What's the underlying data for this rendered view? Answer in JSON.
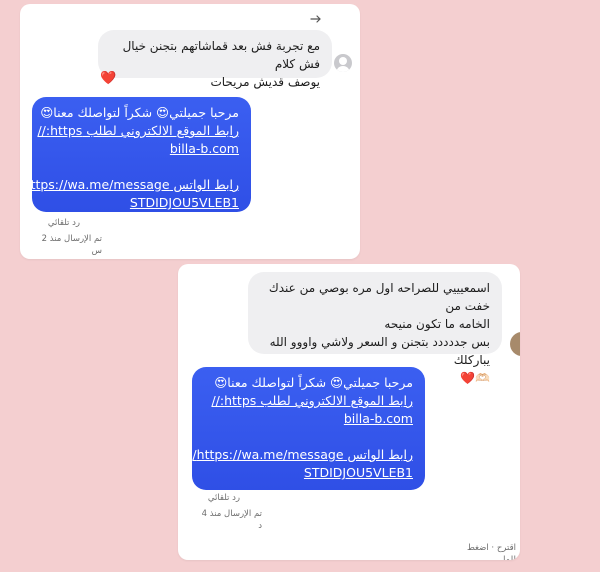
{
  "screenshot_1": {
    "incoming_message": {
      "line1": "مع تجربة فش بعد قماشاتهم بتجنن خيال فش كلام",
      "line2": "يوصف قديش مريحات"
    },
    "reaction": "❤️",
    "reply": {
      "line1": "مرحبا جميلتي😍 شكراً لتواصلك معنا😍",
      "line2": "رابط الموقع الالكتروني لطلب  https://",
      "line3": "billa-b.com",
      "line4": "رابط الواتس https://wa.me/message/",
      "line5": "STDIDJOU5VLEB1"
    },
    "meta_auto_reply": "رد تلقائي",
    "meta_sent": "تم الإرسال منذ 2 س"
  },
  "screenshot_2": {
    "incoming_message": {
      "line1": "اسمعيييي للصراحه اول مره بوصي من عندك خفت من",
      "line2": "الخامه ما تكون منيحه",
      "line3": "بس جددددد بتجنن و السعر ولاشي واووو الله يباركلك",
      "line4": "🫶🏻❤️"
    },
    "reply": {
      "line1": "مرحبا جميلتي😍 شكراً لتواصلك معنا😍",
      "line2": "رابط الموقع الالكتروني لطلب  https://",
      "line3": "billa-b.com",
      "line4": "رابط الواتس https://wa.me/message/",
      "line5": "STDIDJOU5VLEB1"
    },
    "meta_auto_reply": "رد تلقائي",
    "meta_sent": "تم الإرسال منذ 4 د",
    "footer_hint": "اقترح · اضغط للمل."
  },
  "colors": {
    "background": "#f4cfd0",
    "card": "#ffffff",
    "incoming_bubble": "#efeff1",
    "outgoing_bubble": "#3558ef",
    "meta_text": "#6b6b6b",
    "heart": "#e0245e"
  },
  "icons": {
    "forward": "arrow-right-icon",
    "avatar": "profile-avatar-icon",
    "reaction": "heart-icon"
  }
}
